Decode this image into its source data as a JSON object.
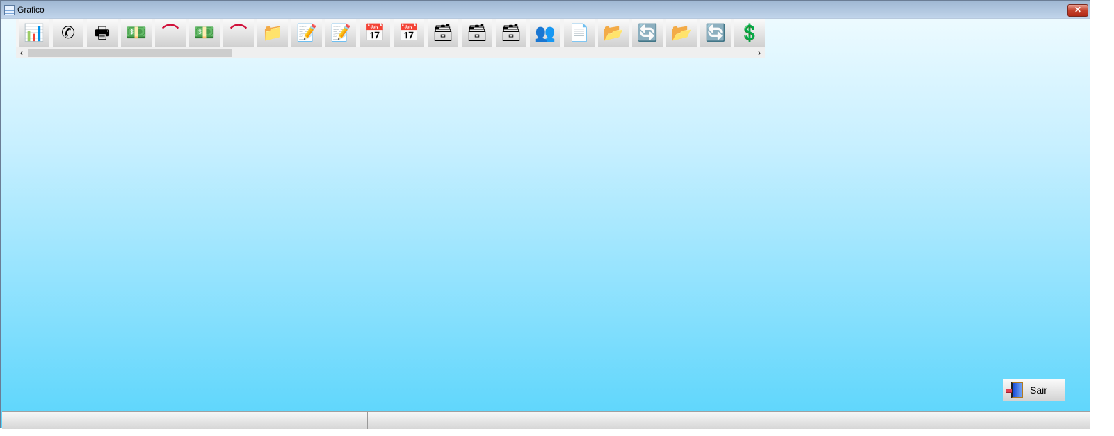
{
  "window": {
    "title": "Grafico",
    "close_label": "✕"
  },
  "toolbar": {
    "buttons": [
      {
        "icon": "bar-chart-icon",
        "glyph": "📊"
      },
      {
        "icon": "phone-icon",
        "glyph": "✆"
      },
      {
        "icon": "printer-icon",
        "glyph": "🖶"
      },
      {
        "icon": "money-icon",
        "glyph": "💵"
      },
      {
        "icon": "bank-logo-icon",
        "glyph": "⌒"
      },
      {
        "icon": "money-icon",
        "glyph": "💵"
      },
      {
        "icon": "bank-logo-icon",
        "glyph": "⌒"
      },
      {
        "icon": "folder-add-icon",
        "glyph": "📁"
      },
      {
        "icon": "notepad-edit-icon",
        "glyph": "📝"
      },
      {
        "icon": "notepad-edit-icon",
        "glyph": "📝"
      },
      {
        "icon": "calendar-check-icon",
        "glyph": "📅"
      },
      {
        "icon": "calendar-check-icon",
        "glyph": "📅"
      },
      {
        "icon": "file-box-icon",
        "glyph": "🗃"
      },
      {
        "icon": "file-box-icon",
        "glyph": "🗃"
      },
      {
        "icon": "file-box-icon",
        "glyph": "🗃"
      },
      {
        "icon": "people-icon",
        "glyph": "👥"
      },
      {
        "icon": "document-icon",
        "glyph": "📄"
      },
      {
        "icon": "folder-open-add-icon",
        "glyph": "📂"
      },
      {
        "icon": "refresh-icon",
        "glyph": "🔄"
      },
      {
        "icon": "folder-open-add-icon",
        "glyph": "📂"
      },
      {
        "icon": "refresh-icon",
        "glyph": "🔄"
      },
      {
        "icon": "dollar-icon",
        "glyph": "💲"
      }
    ]
  },
  "scroll": {
    "left": "‹",
    "right": "›"
  },
  "footer": {
    "exit_label": "Sair"
  }
}
